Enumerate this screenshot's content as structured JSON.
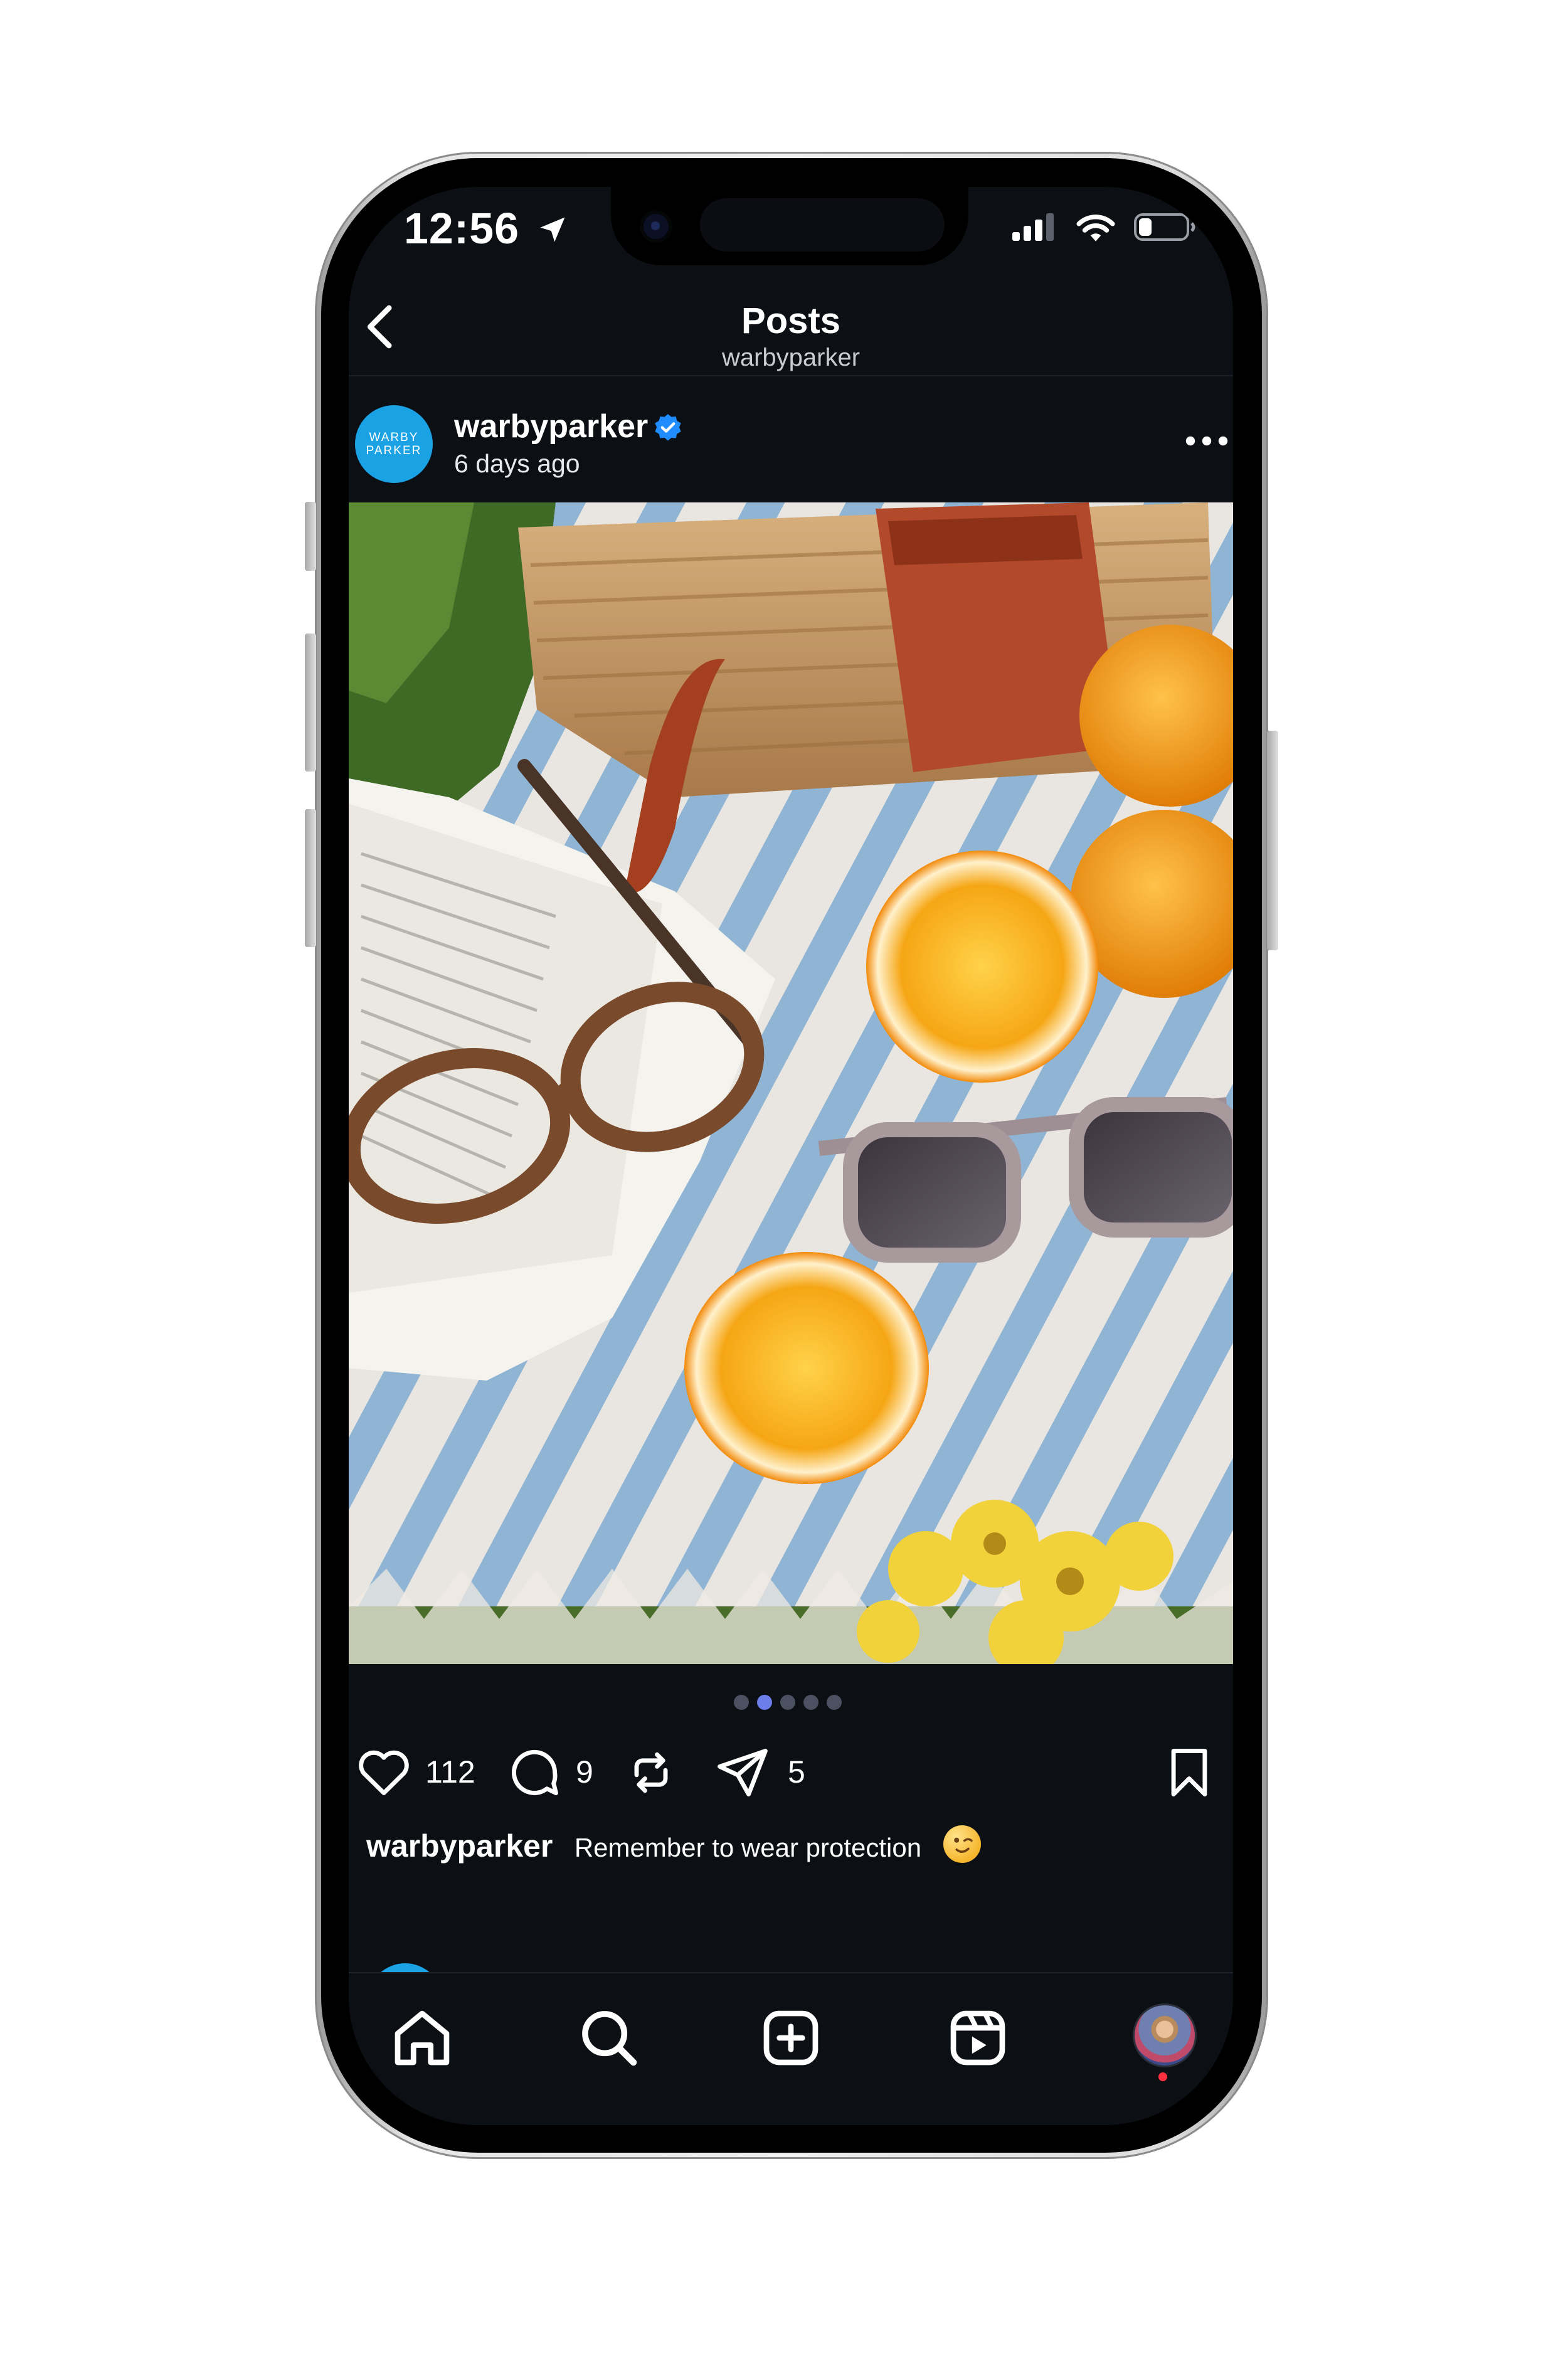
{
  "status_bar": {
    "time": "12:56",
    "icons": [
      "location-arrow-icon",
      "cellular-signal-icon",
      "wifi-icon",
      "battery-icon"
    ]
  },
  "header": {
    "title": "Posts",
    "subtitle": "warbyparker",
    "back_icon": "chevron-left-icon"
  },
  "post": {
    "avatar_text": [
      "WARBY",
      "PARKER"
    ],
    "username": "warbyparker",
    "verified": true,
    "time_ago": "6 days ago",
    "more_icon": "more-horizontal-icon",
    "image_description_icon": "photo",
    "carousel": {
      "total": 5,
      "active_index": 1
    },
    "likes": "112",
    "comments": "9",
    "shares": "5",
    "caption_user": "warbyparker",
    "caption_text": "Remember to wear protection",
    "caption_emoji": "winking-face-emoji"
  },
  "tab_bar": {
    "items": [
      "home-icon",
      "search-icon",
      "create-icon",
      "reels-icon",
      "profile-avatar"
    ],
    "profile_notification": true
  },
  "colors": {
    "background": "#0c0f14",
    "brand_blue": "#1aa2e4",
    "active_dot": "#6b7eea",
    "notification": "#ff3040"
  }
}
